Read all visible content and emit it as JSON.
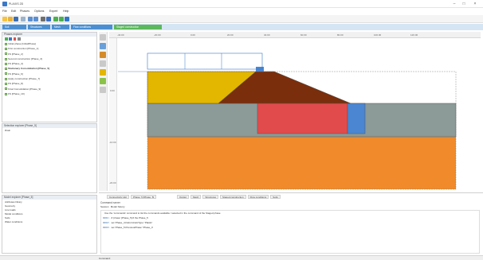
{
  "window": {
    "title": "PLAXIS 2D",
    "controls": [
      "–",
      "□",
      "×"
    ]
  },
  "menu": [
    "File",
    "Edit",
    "Phases",
    "Options",
    "Expert",
    "Help"
  ],
  "toolbar": {
    "icons": [
      "new-project-icon",
      "open-project-icon",
      "save-project-icon",
      "print-icon",
      "undo-icon",
      "redo-icon",
      "select-icon",
      "zoom-icon",
      "calculate-icon",
      "preview-icon",
      "output-icon"
    ]
  },
  "tabs": [
    {
      "label": "Soil",
      "state": "inactive"
    },
    {
      "label": "Structures",
      "state": "inactive"
    },
    {
      "label": "Mesh",
      "state": "inactive"
    },
    {
      "label": "Flow conditions",
      "state": "inactive"
    },
    {
      "label": "Staged construction",
      "state": "active"
    }
  ],
  "phases_panel": {
    "title": "Phases explorer",
    "phases": [
      {
        "label": "Initial phase [InitialPhase]",
        "selected": false
      },
      {
        "label": "First construction [Phase_1]",
        "selected": false
      },
      {
        "label": "FS [Phase_2]",
        "selected": false
      },
      {
        "label": "Second construction [Phase_3]",
        "selected": false
      },
      {
        "label": "FS [Phase_4]",
        "selected": false
      },
      {
        "label": "Stationary Consolidation [Phase_5]",
        "selected": true
      },
      {
        "label": "FS [Phase_6]",
        "selected": false
      },
      {
        "label": "Apply construction [Phase_7]",
        "selected": false
      },
      {
        "label": "FS [Phase_8]",
        "selected": false
      },
      {
        "label": "Final Consolidation [Phase_9]",
        "selected": false
      },
      {
        "label": "FS [Phase_10]",
        "selected": false
      }
    ]
  },
  "selection_panel": {
    "title": "Selection explorer [Phase_5]",
    "items": [
      "Drain"
    ]
  },
  "model_panel": {
    "title": "Model explorer [Phase_5]",
    "items": [
      "Attributes library",
      "Geometry",
      "Line loads",
      "Model conditions",
      "Soils",
      "Water conditions"
    ]
  },
  "ruler": {
    "x_ticks": [
      "-40.00",
      "-20.00",
      "0.00",
      "20.00",
      "40.00",
      "60.00",
      "80.00",
      "100.00",
      "120.00"
    ],
    "y_ticks": [
      "0.00",
      "-10.00",
      "-20.00"
    ]
  },
  "soil_colors": {
    "sand": "#e3b600",
    "embankment": "#7b2e0c",
    "clay": "#8c9a98",
    "soft": "#e24b4b",
    "drain": "#4a86d1",
    "base": "#f08a2a"
  },
  "bottom": {
    "view_tabs": [
      "Connectivity plot",
      "Phase_5 [Phase_5]"
    ],
    "tools": [
      "Output",
      "Mesh",
      "Structures",
      "Staged construction",
      "Flow conditions",
      "Soils"
    ],
    "command_title": "Command runner",
    "session_tabs": [
      "Session",
      "Model history"
    ],
    "log": [
      {
        "prompt": "",
        "text": "Use the 'commands' command to list the commands available / selected in the command of the Staged phase"
      },
      {
        "prompt": "0001>",
        "text": "# 'phase' [Phase_5]  # the Phase_5"
      },
      {
        "prompt": "0002>",
        "text": "set 'Phase_4.DeformCalcType' 'Plastic'"
      },
      {
        "prompt": "0003>",
        "text": "set 'Phase_5.PreviousPhase' 'Phase_4'"
      }
    ]
  },
  "status": {
    "text": "Command:"
  }
}
